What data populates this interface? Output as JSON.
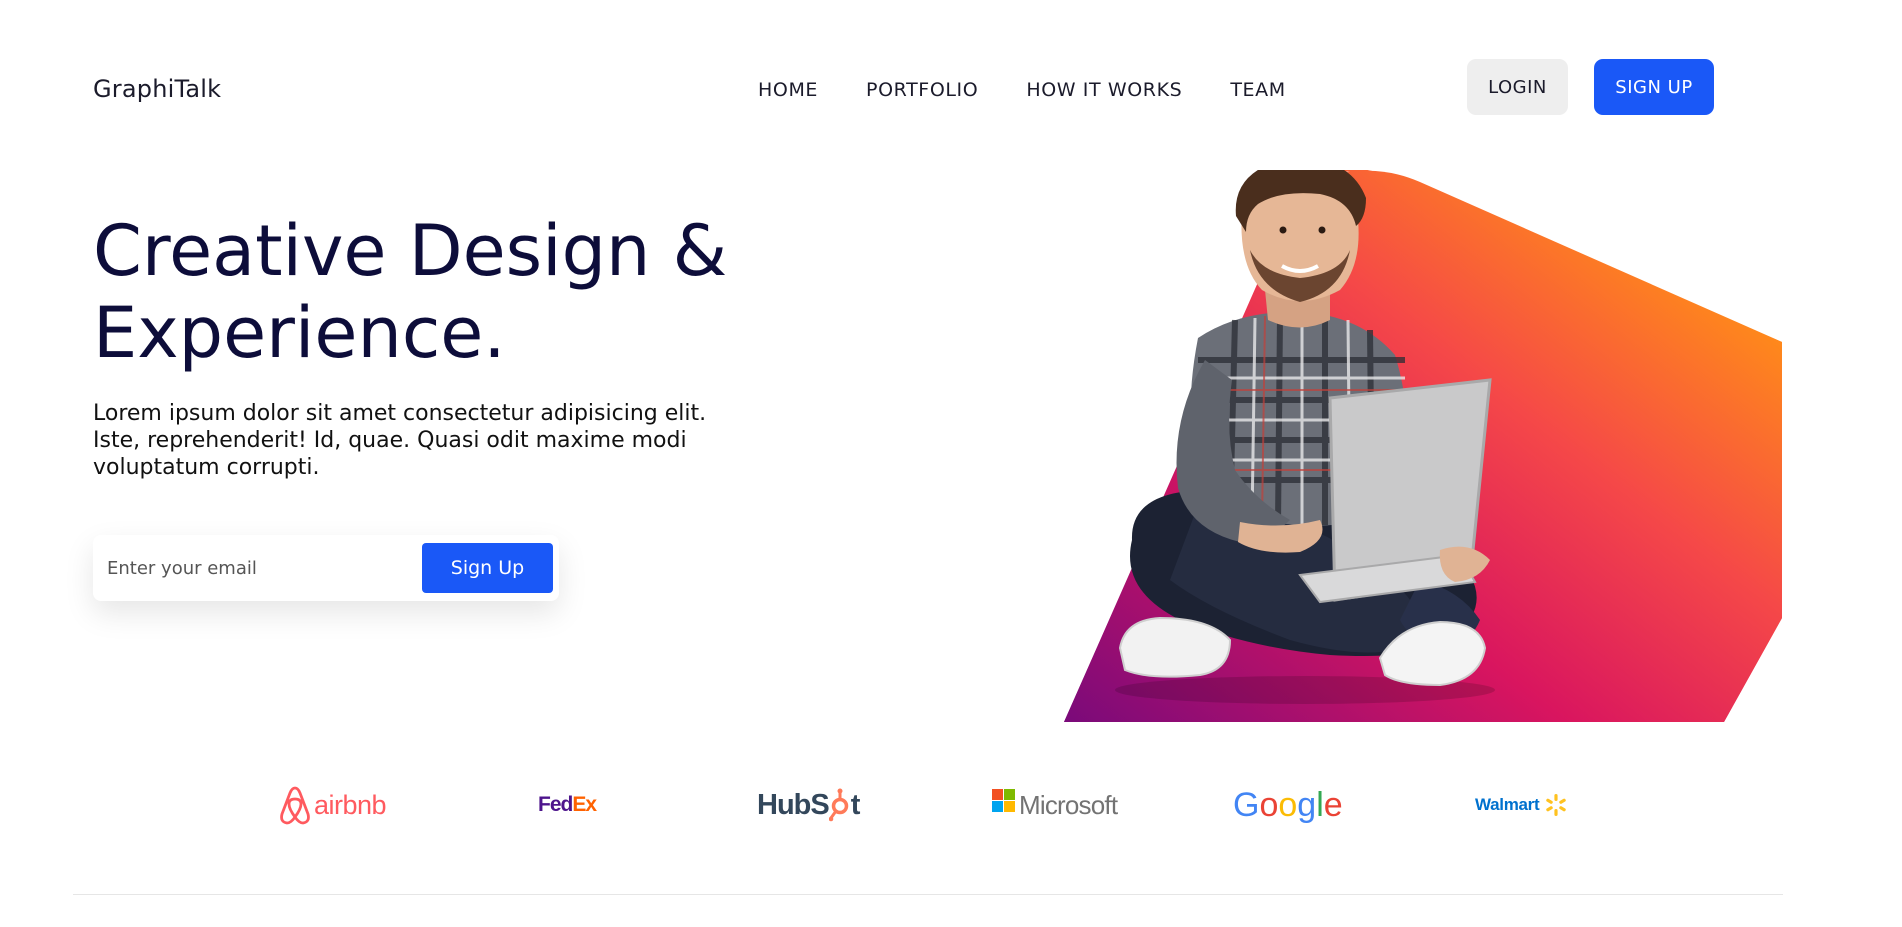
{
  "header": {
    "brand": "GraphiTalk",
    "nav": [
      {
        "label": "HOME"
      },
      {
        "label": "PORTFOLIO"
      },
      {
        "label": "HOW IT WORKS"
      },
      {
        "label": "TEAM"
      }
    ],
    "login_label": "LOGIN",
    "signup_label": "SIGN UP"
  },
  "hero": {
    "title_line1": "Creative Design &",
    "title_line2": "Experience.",
    "description": "Lorem ipsum dolor sit amet consectetur adipisicing elit. Iste, reprehenderit! Id, quae. Quasi odit maxime modi voluptatum corrupti.",
    "email_placeholder": "Enter your email",
    "cta_label": "Sign Up"
  },
  "partners": [
    {
      "name": "airbnb",
      "icon": "airbnb-logo"
    },
    {
      "name": "FedEx",
      "fed": "Fed",
      "ex": "Ex",
      "icon": "fedex-logo"
    },
    {
      "name": "HubSpot",
      "hub": "Hub",
      "s": "S",
      "pot": "pot",
      "icon": "hubspot-logo"
    },
    {
      "name": "Microsoft",
      "icon": "microsoft-logo"
    },
    {
      "name": "Google",
      "letters": [
        "G",
        "o",
        "o",
        "g",
        "l",
        "e"
      ],
      "icon": "google-logo"
    },
    {
      "name": "Walmart",
      "icon": "walmart-logo"
    }
  ],
  "colors": {
    "primary": "#1a58f7",
    "heading": "#0d0d3a",
    "gradient_start": "#7a0a7a",
    "gradient_mid": "#f43f56",
    "gradient_end": "#ffc800",
    "airbnb": "#ff5a5f",
    "fedex_purple": "#4d148c",
    "fedex_orange": "#ff6200",
    "hubspot_gray": "#33475b",
    "hubspot_orange": "#ff7a59",
    "microsoft_gray": "#737373",
    "walmart_blue": "#0071ce",
    "walmart_yellow": "#ffc220"
  }
}
